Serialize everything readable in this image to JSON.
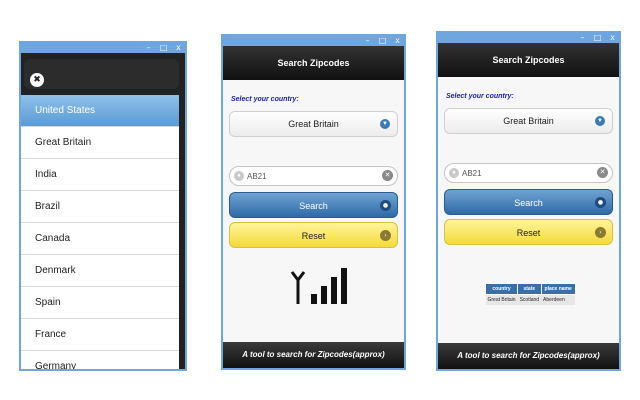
{
  "window_controls": {
    "minimize": "–",
    "maximize": "□",
    "close": "x"
  },
  "picker": {
    "close_glyph": "✖",
    "countries": [
      "United States",
      "Great Britain",
      "India",
      "Brazil",
      "Canada",
      "Denmark",
      "Spain",
      "France",
      "Germany"
    ],
    "selected_index": 0
  },
  "app": {
    "header_title": "Search Zipcodes",
    "country_prompt": "Select your country:",
    "selected_country": "Great Britain",
    "zip_value": "AB21",
    "search_label": "Search",
    "reset_label": "Reset",
    "footer_text": "A tool to search for Zipcodes(approx)"
  },
  "results": {
    "columns": [
      "country",
      "state",
      "place name"
    ],
    "rows": [
      [
        "Great Britain",
        "Scotland",
        "Aberdeen"
      ]
    ]
  },
  "colors": {
    "search_button": "#2f6aa7",
    "reset_button": "#f5da39",
    "selected_item": "#5a9bd5",
    "prompt_text": "#1b1bb0"
  }
}
